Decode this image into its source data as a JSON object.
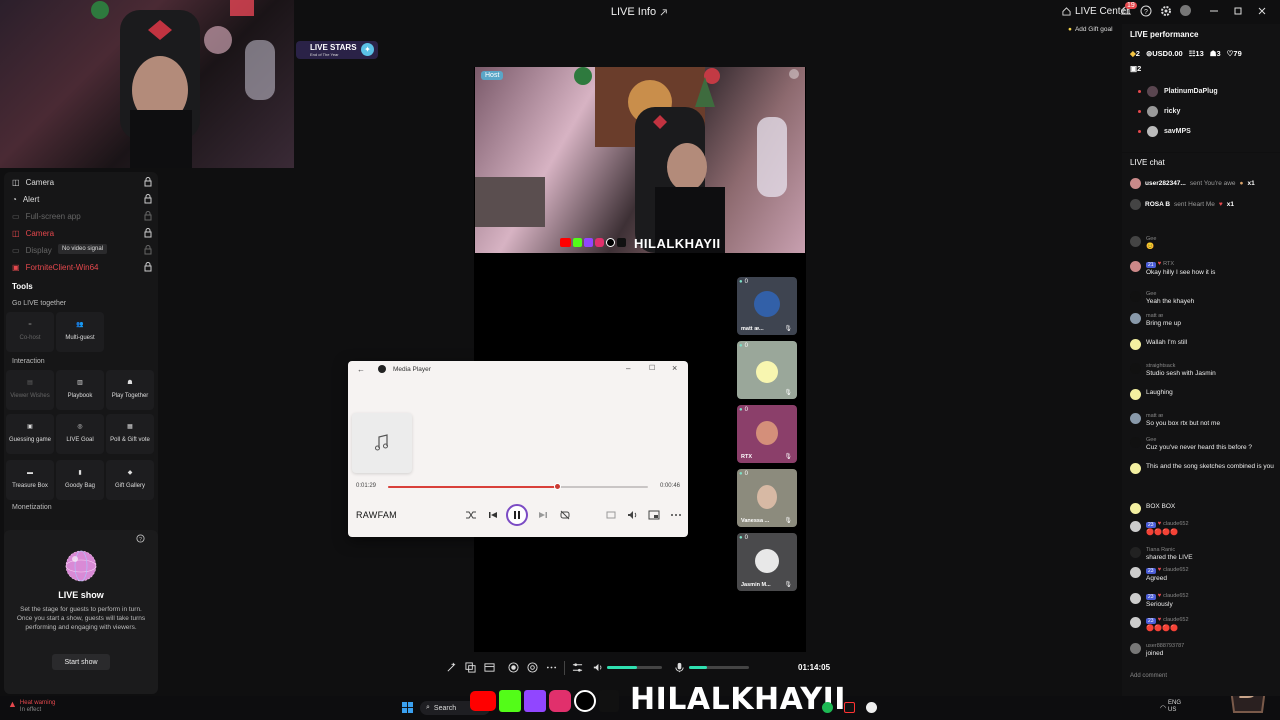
{
  "header": {
    "title": "LIVE Info",
    "live_center": "LIVE Center",
    "notif_count": "19",
    "add_gift_goal": "Add Gift goal"
  },
  "live_stars": {
    "title": "LIVE STARS",
    "subtitle": "End of The Year"
  },
  "sources": [
    {
      "label": "Camera",
      "state": "normal"
    },
    {
      "label": "Alert",
      "state": "normal"
    },
    {
      "label": "Full-screen app",
      "state": "dim"
    },
    {
      "label": "Camera",
      "state": "red"
    },
    {
      "label": "Display",
      "state": "dim"
    },
    {
      "label": "FortniteClient-Win64",
      "state": "red"
    }
  ],
  "tooltip": "No video signal",
  "tools": {
    "title": "Tools",
    "go_live_together": "Go LIVE together",
    "interaction": "Interaction",
    "monetization": "Monetization",
    "items": {
      "cohost": "Co-host",
      "multiguest": "Multi-guest",
      "viewer_wishes": "Viewer Wishes",
      "playbook": "Playbook",
      "play_together": "Play Together",
      "guessing_game": "Guessing game",
      "live_goal": "LIVE Goal",
      "poll_gift_vote": "Poll & Gift vote",
      "treasure_box": "Treasure Box",
      "goody_bag": "Goody Bag",
      "gift_gallery": "Gift Gallery"
    }
  },
  "live_show": {
    "title": "LIVE show",
    "description": "Set the stage for guests to perform in turn. Once you start a show, guests will take turns performing and engaging with viewers.",
    "start_button": "Start show"
  },
  "stage": {
    "host_badge": "Host",
    "host_handle": "HILALKHAYII",
    "guests": [
      {
        "count": "0",
        "name": "matt ᴂ..."
      },
      {
        "count": "0",
        "name": ""
      },
      {
        "count": "0",
        "name": "RTX"
      },
      {
        "count": "0",
        "name": "Vanessa ..."
      },
      {
        "count": "0",
        "name": "Jasmin M..."
      }
    ]
  },
  "media_player": {
    "title": "Media Player",
    "current_time": "0:01:29",
    "total_time": "0:00:46",
    "progress": 0.65,
    "song": "RAWFAM"
  },
  "controls": {
    "timer": "01:14:05",
    "volume_level": 0.55,
    "mic_level": 0.3
  },
  "taskbar": {
    "heat_warning": "Heat warning",
    "heat_sub": "In effect",
    "search": "Search",
    "handle": "HILALKHAYII",
    "lang1": "ENG",
    "lang2": "US"
  },
  "performance": {
    "title": "LIVE performance",
    "diamonds": "2",
    "usd": "USD0.00",
    "viewers": "13",
    "guests": "3",
    "likes": "79",
    "extra": "2",
    "top_viewers": [
      "PlatinumDaPlug",
      "ricky",
      "savMPS"
    ]
  },
  "chat": {
    "title": "LIVE chat",
    "gifts": [
      {
        "user": "user282347...",
        "action": "sent You're awe",
        "count": "x1"
      },
      {
        "user": "ROSA B",
        "action": "sent Heart Me",
        "count": "x1"
      }
    ],
    "messages": [
      {
        "name": "Gee",
        "text": "😊",
        "av": "#444"
      },
      {
        "name": "RTX",
        "level": "21",
        "text": "Okay hilly I see how it is",
        "av": "#c88"
      },
      {
        "name": "Gee",
        "text": "Yeah the khayeh",
        "av": "#111"
      },
      {
        "name": "matt ᴂ",
        "text": "Bring me up",
        "av": "#89a"
      },
      {
        "name": "",
        "text": "Wallah I'm still",
        "av": "#f3f0a0"
      },
      {
        "name": "straightsack",
        "text": "Studio sesh with Jasmin",
        "av": "#111"
      },
      {
        "name": "",
        "text": "Laughing",
        "av": "#f3f0a0"
      },
      {
        "name": "matt ᴂ",
        "text": "So you box rtx but not me",
        "av": "#89a"
      },
      {
        "name": "Gee",
        "text": "Cuz you've never heard this before ?",
        "av": "#111"
      },
      {
        "name": "",
        "text": "This and the song sketches combined is you",
        "av": "#f3f0a0"
      },
      {
        "name": "",
        "text": "BOX BOX",
        "av": "#f3f0a0"
      },
      {
        "name": "claude652",
        "level": "23",
        "text": "🔴🔴🔴🔴",
        "av": "#ccc"
      },
      {
        "name": "Tiana Ranic",
        "text": "shared the LIVE",
        "av": "#222"
      },
      {
        "name": "claude652",
        "level": "23",
        "text": "Agreed",
        "av": "#ccc"
      },
      {
        "name": "claude652",
        "level": "23",
        "text": "Seriously",
        "av": "#ccc"
      },
      {
        "name": "claude652",
        "level": "23",
        "text": "🔴🔴🔴🔴",
        "av": "#ccc"
      },
      {
        "name": "user888793787",
        "text": "joined",
        "av": "#777"
      }
    ],
    "placeholder": "Add comment"
  }
}
